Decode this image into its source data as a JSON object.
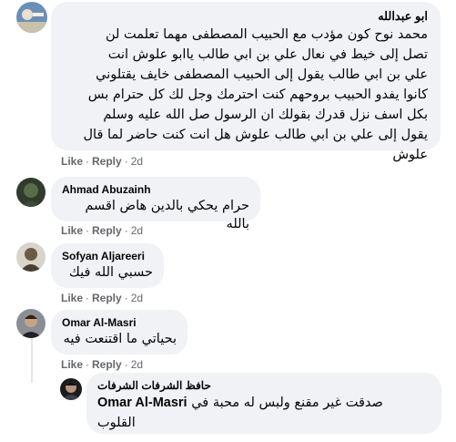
{
  "actions": {
    "like": "Like",
    "reply": "Reply",
    "dot": "·"
  },
  "comments": [
    {
      "author": "ابو عبدالله",
      "lines": [
        "محمد نوح كون مؤدب مع الحبيب المصطفى مهما تعلمت لن",
        "تصل إلى خيط في نعال علي بن ابي طالب ياابو علوش انت",
        "علي بن ابي طالب يقول إلى الحبيب المصطفى خايف يقتلوني",
        "كانوا يفدو الحبيب بروحهم كنت احترمك وجل لك كل حترام بس",
        "بكل اسف نزل قدرك بقولك ان الرسول صل الله عليه وسلم",
        "يقول إلى علي بن ابي طالب علوش هل انت كنت حاضر لما قال",
        "علوش"
      ],
      "time": "2d"
    },
    {
      "author": "Ahmad Abuzainh",
      "text": "حرام يحكي بالدين هاض اقسم بالله",
      "time": "2d"
    },
    {
      "author": "Sofyan Aljareeri",
      "text": "حسبي الله فيك",
      "time": "2d"
    },
    {
      "author": "Omar Al-Masri",
      "text": "بحياتي ما اقتنعت فيه",
      "time": "2d"
    }
  ],
  "reply": {
    "author": "حافظ الشرفات الشرفات",
    "mention": "Omar Al-Masri",
    "line1": "صدقت غير مقنع ولبس له محبة في",
    "line2": "القلوب"
  }
}
